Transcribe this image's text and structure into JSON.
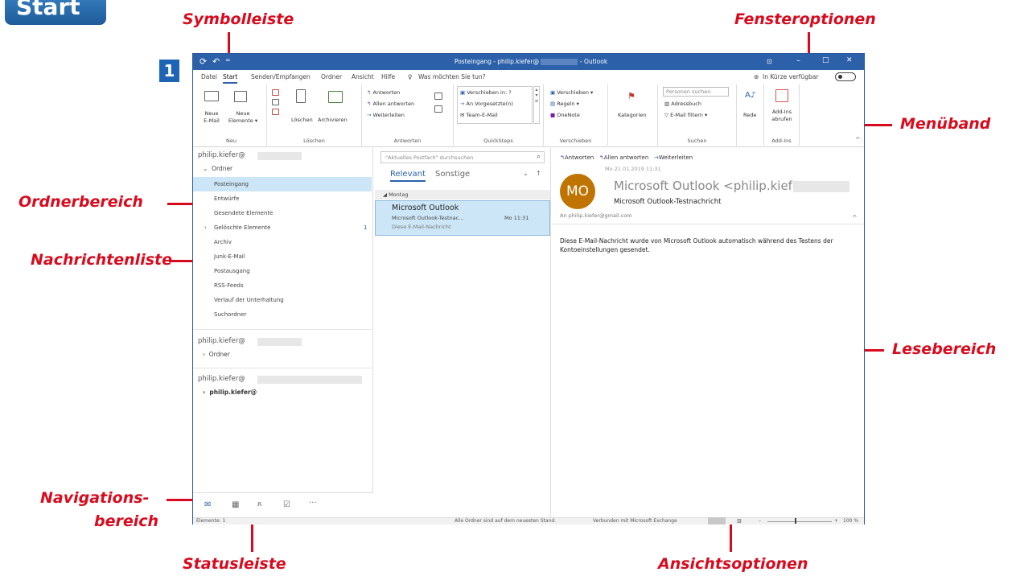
{
  "badge": "Start",
  "step": "1",
  "callouts": {
    "symbolleiste": "Symbolleiste",
    "fensteroptionen": "Fensteroptionen",
    "menueband": "Menüband",
    "ordnerbereich": "Ordnerbereich",
    "nachrichtenliste": "Nachrichtenliste",
    "lesebereich": "Lesebereich",
    "navigations_1": "Navigations-",
    "navigations_2": "bereich",
    "statusleiste": "Statusleiste",
    "ansichtsoptionen": "Ansichtsoptionen"
  },
  "window": {
    "title_left": "Posteingang - philip.kiefer@",
    "title_right": "- Outlook",
    "title_controls": [
      "⊡",
      "–",
      "□",
      "✕"
    ]
  },
  "menu": {
    "tabs": [
      "Datei",
      "Start",
      "Senden/Empfangen",
      "Ordner",
      "Ansicht",
      "Hilfe"
    ],
    "tellme": "Was möchten Sie tun?",
    "coming_soon": "In Kürze verfügbar"
  },
  "ribbon": {
    "neu": {
      "label": "Neu",
      "new_email_1": "Neue",
      "new_email_2": "E-Mail",
      "new_items_1": "Neue",
      "new_items_2": "Elemente ▾"
    },
    "loeschen": {
      "label": "Löschen",
      "delete": "Löschen",
      "archive": "Archivieren"
    },
    "antworten": {
      "label": "Antworten",
      "reply": "Antworten",
      "reply_all": "Allen antworten",
      "forward": "Weiterleiten"
    },
    "quicksteps": {
      "label": "QuickSteps",
      "move_to": "Verschieben in: ?",
      "to_manager": "An Vorgesetzte(n)",
      "team_email": "Team-E-Mail"
    },
    "verschieben": {
      "label": "Verschieben",
      "move": "Verschieben ▾",
      "rules": "Regeln ▾",
      "onenote": "OneNote"
    },
    "tags": {
      "categories": "Kategorien"
    },
    "suchen": {
      "label": "Suchen",
      "search_people": "Personen suchen",
      "address_book": "Adressbuch",
      "filter_email": "E-Mail filtern ▾"
    },
    "speech": {
      "label": "Rede"
    },
    "addins": {
      "label": "Add-Ins",
      "get_1": "Add-Ins",
      "get_2": "abrufen"
    }
  },
  "folders": {
    "account1": "philip.kiefer@",
    "ordner": "Ordner",
    "items": [
      {
        "name": "Posteingang",
        "count": ""
      },
      {
        "name": "Entwürfe",
        "count": ""
      },
      {
        "name": "Gesendete Elemente",
        "count": ""
      },
      {
        "name": "Gelöschte Elemente",
        "count": "1"
      },
      {
        "name": "Archiv",
        "count": ""
      },
      {
        "name": "Junk-E-Mail",
        "count": ""
      },
      {
        "name": "Postausgang",
        "count": ""
      },
      {
        "name": "RSS-Feeds",
        "count": ""
      },
      {
        "name": "Verlauf der Unterhaltung",
        "count": ""
      },
      {
        "name": "Suchordner",
        "count": ""
      }
    ],
    "account2": "philip.kiefer@",
    "ordner2": "Ordner",
    "account3": "philip.kiefer@",
    "sub3": "philip.kiefer@"
  },
  "msglist": {
    "search_placeholder": "\"Aktuelles Postfach\" durchsuchen",
    "tab_relevant": "Relevant",
    "tab_other": "Sonstige",
    "group": "Montag",
    "msg": {
      "from": "Microsoft Outlook",
      "subject": "Microsoft Outlook-Testnac...",
      "time": "Mo 11:31",
      "preview": "Diese E-Mail-Nachricht"
    }
  },
  "reading": {
    "actions": [
      "Antworten",
      "Allen antworten",
      "Weiterleiten"
    ],
    "date": "Mo 21.01.2019 11:31",
    "avatar": "MO",
    "sender": "Microsoft Outlook <philip.kiefer@",
    "subject": "Microsoft Outlook-Testnachricht",
    "to": "An   philip.kiefer@gmail.com",
    "body": "Diese E-Mail-Nachricht wurde von Microsoft Outlook automatisch während des Testens der Kontoeinstellungen gesendet."
  },
  "status": {
    "items": "Elemente: 1",
    "sync": "Alle Ordner sind auf dem neuesten Stand.",
    "connected": "Verbunden mit Microsoft Exchange",
    "zoom": "100 %"
  },
  "colors": {
    "accent": "#2c61a9",
    "callout": "#d80b1e",
    "selection": "#cde6f7",
    "avatar": "#c07400"
  }
}
